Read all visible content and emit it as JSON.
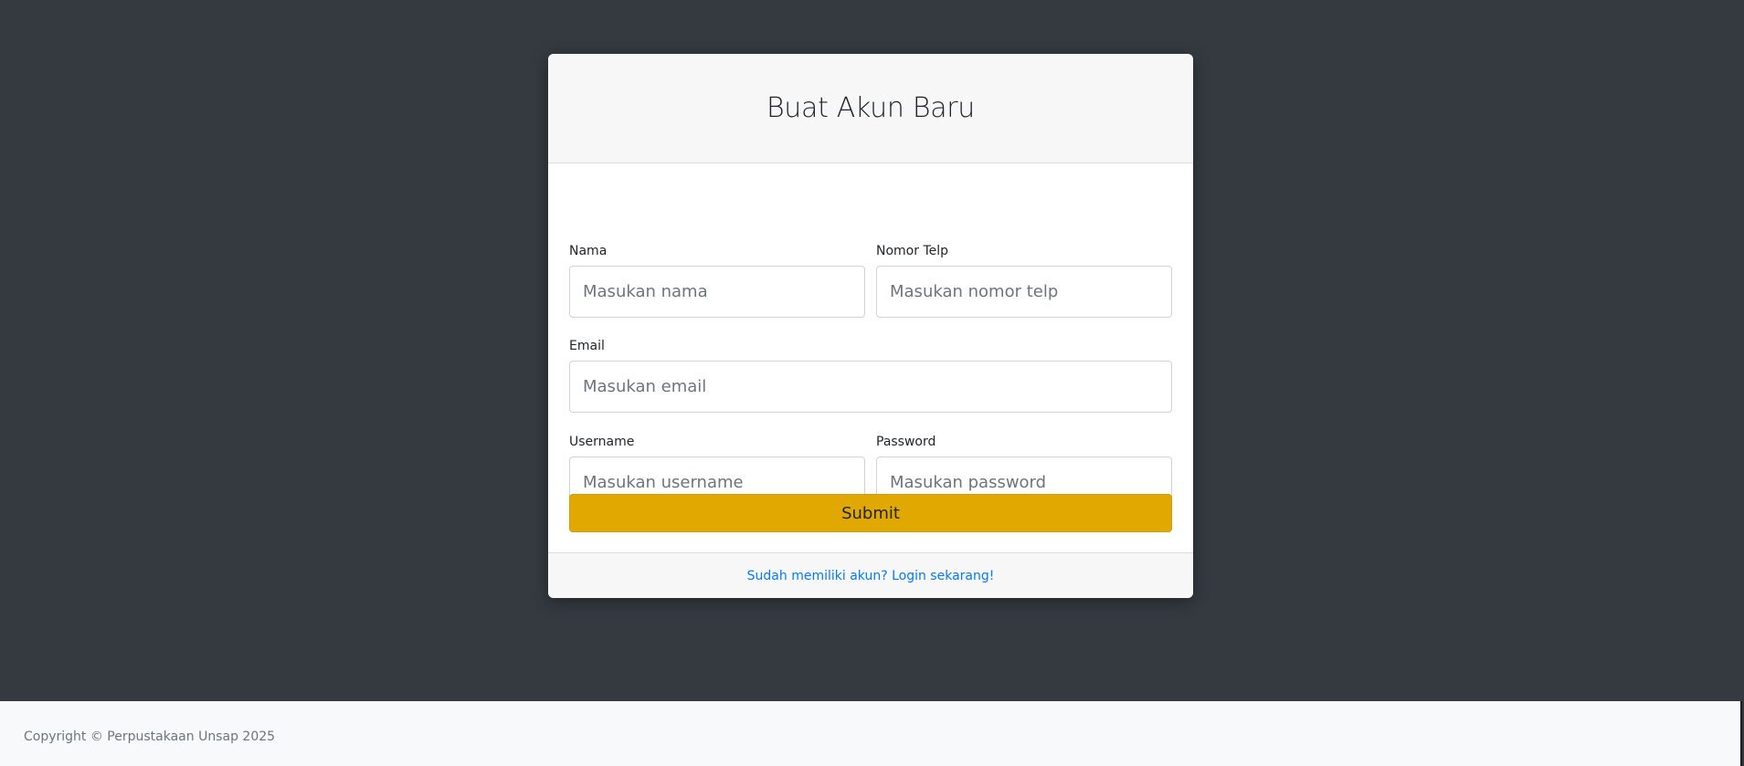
{
  "page": {
    "background_color": "#343a40"
  },
  "card": {
    "title": "Buat Akun Baru",
    "fields": {
      "nama": {
        "label": "Nama",
        "placeholder": "Masukan nama",
        "value": ""
      },
      "nomor_telp": {
        "label": "Nomor Telp",
        "placeholder": "Masukan nomor telp",
        "value": ""
      },
      "email": {
        "label": "Email",
        "placeholder": "Masukan email",
        "value": ""
      },
      "username": {
        "label": "Username",
        "placeholder": "Masukan username",
        "value": ""
      },
      "password": {
        "label": "Password",
        "placeholder": "Masukan password",
        "value": ""
      }
    },
    "submit_label": "Submit",
    "submit_color": "#e0a800",
    "footer_link": "Sudah memiliki akun? Login sekarang!",
    "link_color": "#007bff"
  },
  "footer": {
    "copyright": "Copyright © Perpustakaan Unsap 2025"
  }
}
